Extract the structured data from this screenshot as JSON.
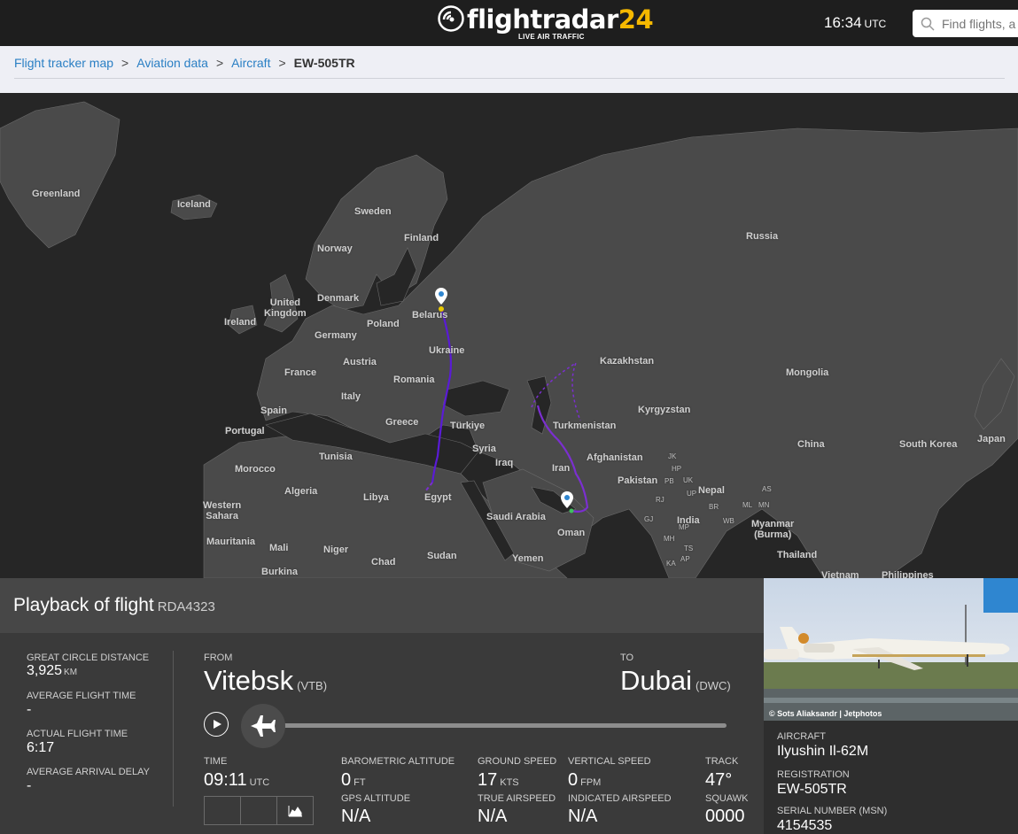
{
  "header": {
    "logo_main": "flightradar",
    "logo_num": "24",
    "logo_sub": "LIVE AIR TRAFFIC",
    "time": "16:34",
    "time_zone": "UTC",
    "search_placeholder": "Find flights, a"
  },
  "breadcrumb": {
    "items": [
      "Flight tracker map",
      "Aviation data",
      "Aircraft"
    ],
    "current": "EW-505TR"
  },
  "map": {
    "labels": {
      "greenland": "Greenland",
      "iceland": "Iceland",
      "sweden": "Sweden",
      "finland": "Finland",
      "norway": "Norway",
      "russia": "Russia",
      "denmark": "Denmark",
      "united_kingdom": "United\nKingdom",
      "ireland": "Ireland",
      "belarus": "Belarus",
      "poland": "Poland",
      "germany": "Germany",
      "ukraine": "Ukraine",
      "austria": "Austria",
      "kazakhstan": "Kazakhstan",
      "mongolia": "Mongolia",
      "france": "France",
      "romania": "Romania",
      "italy": "Italy",
      "spain": "Spain",
      "kyrgyzstan": "Kyrgyzstan",
      "greece": "Greece",
      "turkiye": "Türkiye",
      "turkmenistan": "Turkmenistan",
      "portugal": "Portugal",
      "china": "China",
      "south_korea": "South Korea",
      "japan": "Japan",
      "tunisia": "Tunisia",
      "syria": "Syria",
      "afghanistan": "Afghanistan",
      "iraq": "Iraq",
      "iran": "Iran",
      "morocco": "Morocco",
      "pakistan": "Pakistan",
      "algeria": "Algeria",
      "libya": "Libya",
      "egypt": "Egypt",
      "nepal": "Nepal",
      "western_sahara": "Western\nSahara",
      "saudi_arabia": "Saudi Arabia",
      "india": "India",
      "myanmar": "Myanmar\n(Burma)",
      "oman": "Oman",
      "mauritania": "Mauritania",
      "mali": "Mali",
      "niger": "Niger",
      "chad": "Chad",
      "sudan": "Sudan",
      "yemen": "Yemen",
      "thailand": "Thailand",
      "burkina": "Burkina",
      "vietnam": "Vietnam",
      "philippines": "Philippines"
    },
    "small_labels": [
      "JK",
      "HP",
      "UK",
      "PB",
      "UP",
      "RJ",
      "GJ",
      "BR",
      "MP",
      "WB",
      "MH",
      "TS",
      "KA",
      "AP",
      "ML",
      "MN",
      "AS"
    ],
    "colors": {
      "land": "#4a4a4a",
      "water": "#262626",
      "route_a": "#5a1bd6",
      "route_b": "#7b2fd0",
      "pin": "#ffffff"
    }
  },
  "flight": {
    "title": "Playback of flight",
    "callsign": "RDA4323",
    "great_circle_label": "GREAT CIRCLE DISTANCE",
    "great_circle_value": "3,925",
    "great_circle_unit": "KM",
    "avg_time_label": "AVERAGE FLIGHT TIME",
    "avg_time_value": "-",
    "actual_time_label": "ACTUAL FLIGHT TIME",
    "actual_time_value": "6:17",
    "avg_delay_label": "AVERAGE ARRIVAL DELAY",
    "avg_delay_value": "-",
    "from_label": "FROM",
    "from_city": "Vitebsk",
    "from_code": "(VTB)",
    "to_label": "TO",
    "to_city": "Dubai",
    "to_code": "(DWC)",
    "progress": 0.0,
    "time_label": "TIME",
    "time_value": "09:11",
    "time_unit": "UTC",
    "baro_alt_label": "BAROMETRIC ALTITUDE",
    "baro_alt_value": "0",
    "baro_alt_unit": "FT",
    "gps_alt_label": "GPS ALTITUDE",
    "gps_alt_value": "N/A",
    "ground_speed_label": "GROUND SPEED",
    "ground_speed_value": "17",
    "ground_speed_unit": "KTS",
    "true_airspeed_label": "TRUE AIRSPEED",
    "true_airspeed_value": "N/A",
    "vertical_speed_label": "VERTICAL SPEED",
    "vertical_speed_value": "0",
    "vertical_speed_unit": "FPM",
    "indicated_airspeed_label": "INDICATED AIRSPEED",
    "indicated_airspeed_value": "N/A",
    "track_label": "TRACK",
    "track_value": "47°",
    "squawk_label": "SQUAWK",
    "squawk_value": "0000"
  },
  "aircraft": {
    "photo_credit": "© Sots Aliaksandr | Jetphotos",
    "aircraft_label": "AIRCRAFT",
    "aircraft_value": "Ilyushin Il-62M",
    "registration_label": "REGISTRATION",
    "registration_value": "EW-505TR",
    "serial_label": "SERIAL NUMBER (MSN)",
    "serial_value": "4154535"
  }
}
